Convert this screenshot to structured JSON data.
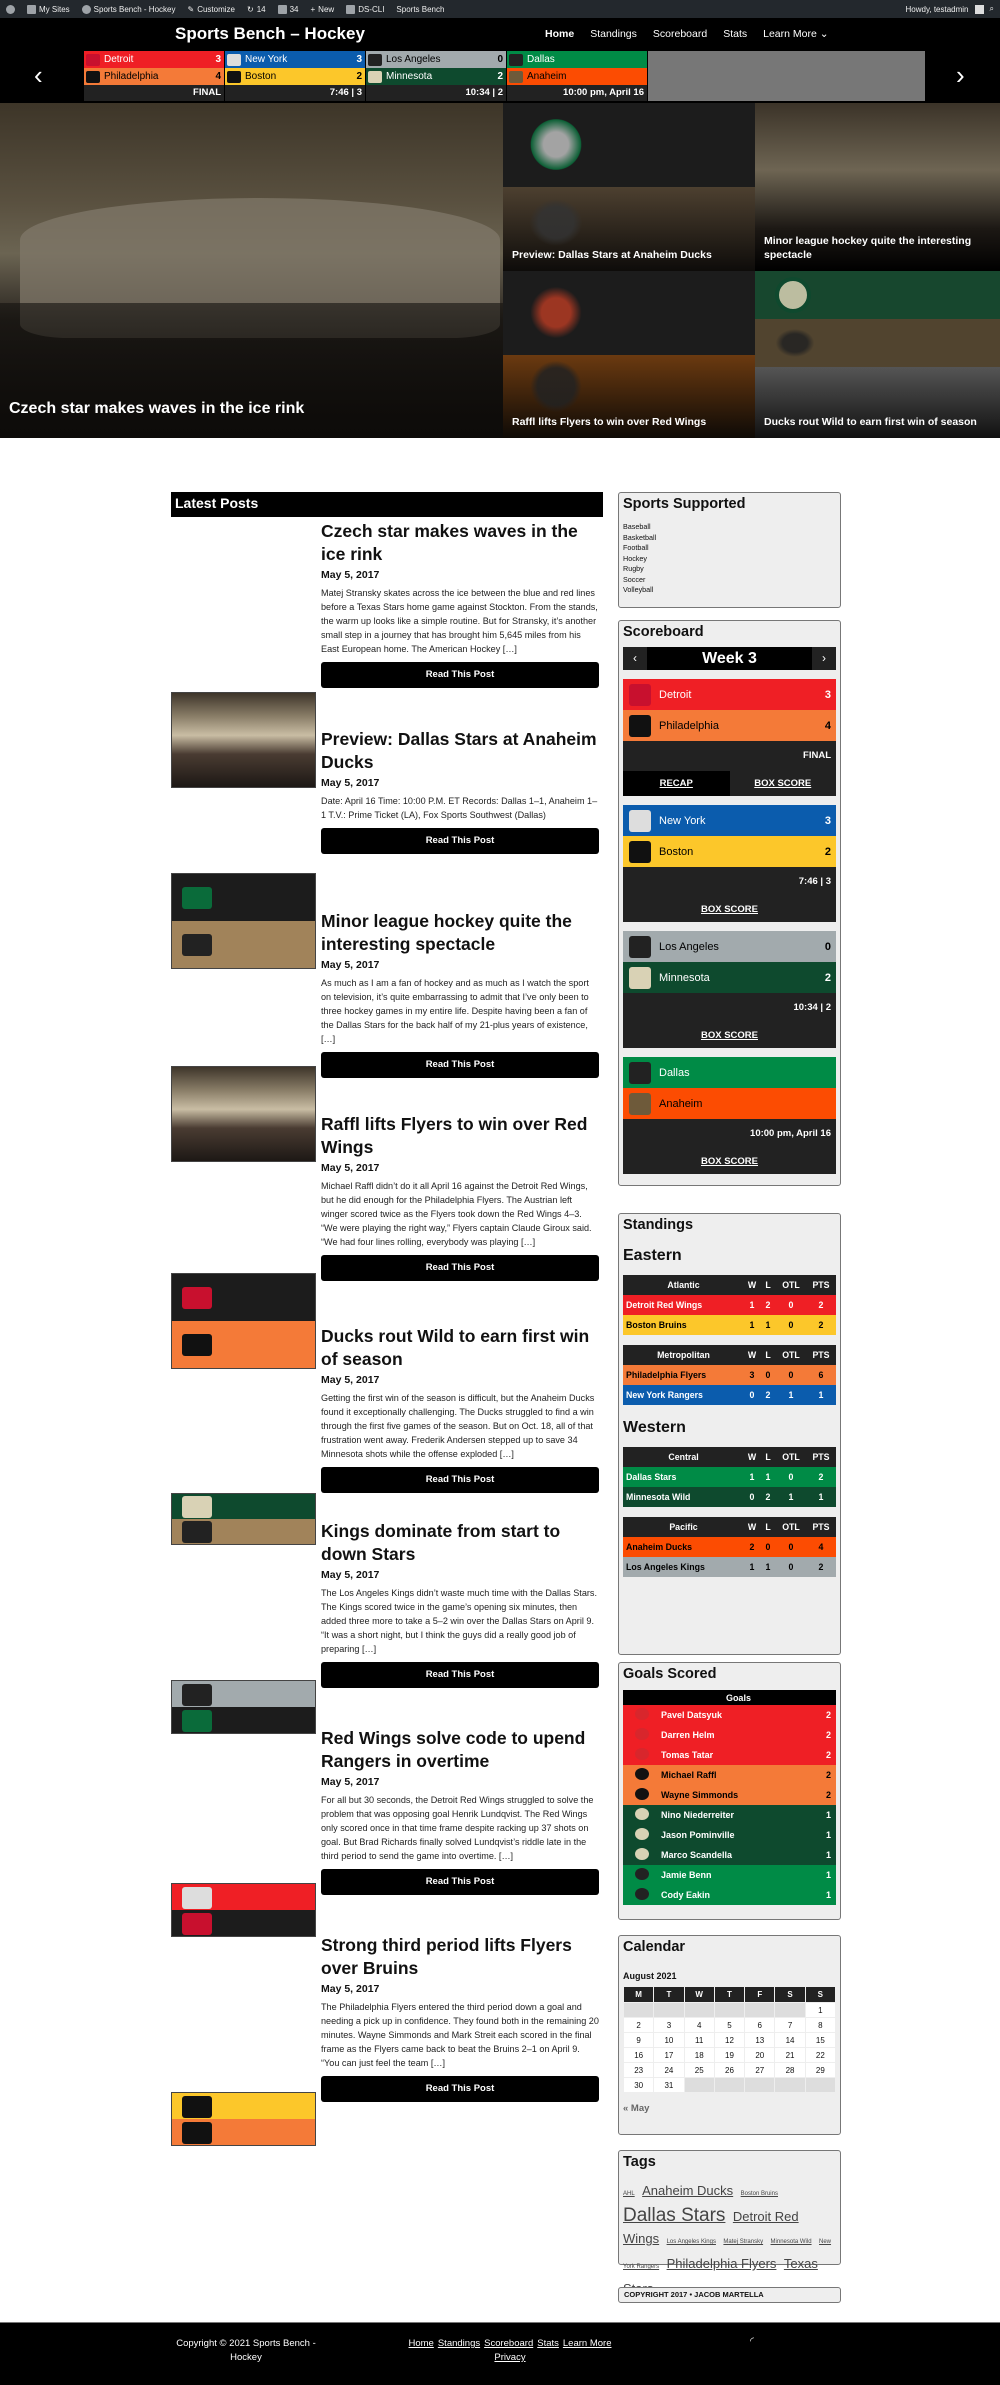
{
  "admin_bar": {
    "items": [
      "My Sites",
      "Sports Bench - Hockey",
      "Customize",
      "14",
      "34",
      "New",
      "DS-CLI",
      "Sports Bench"
    ],
    "greeting": "Howdy, testadmin"
  },
  "header": {
    "site_title": "Sports Bench – Hockey",
    "nav": [
      {
        "label": "Home",
        "active": true
      },
      {
        "label": "Standings"
      },
      {
        "label": "Scoreboard"
      },
      {
        "label": "Stats"
      },
      {
        "label": "Learn More ⌄"
      }
    ],
    "prev_arrow": "‹",
    "next_arrow": "›"
  },
  "ticker": [
    {
      "away": {
        "name": "Detroit",
        "score": "3",
        "color": "#ef1f25",
        "text": "#fff"
      },
      "home": {
        "name": "Philadelphia",
        "score": "4",
        "color": "#f47a38",
        "text": "#000"
      },
      "status": "FINAL"
    },
    {
      "away": {
        "name": "New York",
        "score": "3",
        "color": "#0b5cad",
        "text": "#fff"
      },
      "home": {
        "name": "Boston",
        "score": "2",
        "color": "#fcc72a",
        "text": "#000"
      },
      "status": "7:46 | 3"
    },
    {
      "away": {
        "name": "Los Angeles",
        "score": "0",
        "color": "#a2aaad",
        "text": "#000"
      },
      "home": {
        "name": "Minnesota",
        "score": "2",
        "color": "#0e4a2e",
        "text": "#fff"
      },
      "status": "10:34 | 2"
    },
    {
      "away": {
        "name": "Dallas",
        "score": "",
        "color": "#008b46",
        "text": "#fff"
      },
      "home": {
        "name": "Anaheim",
        "score": "",
        "color": "#fc4c02",
        "text": "#000"
      },
      "status": "10:00 pm, April 16"
    }
  ],
  "hero": {
    "main": "Czech star makes waves in the ice rink",
    "tiles": [
      "Preview: Dallas Stars at Anaheim Ducks",
      "Minor league hockey quite the interesting spectacle",
      "Raffl lifts Flyers to win over Red Wings",
      "Ducks rout Wild to earn first win of season"
    ]
  },
  "latest_posts": {
    "heading": "Latest Posts",
    "button_label": "Read This Post",
    "posts": [
      {
        "title": "Czech star makes waves in the ice rink",
        "date": "May 5, 2017",
        "excerpt": "Matej Stransky skates across the ice between the blue and red lines before a Texas Stars home game against Stockton. From the stands, the warm up looks like a simple routine. But for Stransky, it’s another small step in a journey that has brought him 5,645 miles from his East European home. The American Hockey […]"
      },
      {
        "title": "Preview: Dallas Stars at Anaheim Ducks",
        "date": "May 5, 2017",
        "excerpt": "Date: April 16 Time: 10:00 P.M. ET Records: Dallas 1–1, Anaheim 1–1 T.V.: Prime Ticket (LA), Fox Sports Southwest (Dallas)"
      },
      {
        "title": "Minor league hockey quite the interesting spectacle",
        "date": "May 5, 2017",
        "excerpt": "As much as I am a fan of hockey and as much as I watch the sport on television, it’s quite embarrassing to admit that I’ve only been to three hockey games in my entire life. Despite having been a fan of the Dallas Stars for the back half of my 21-plus years of existence, […]"
      },
      {
        "title": "Raffl lifts Flyers to win over Red Wings",
        "date": "May 5, 2017",
        "excerpt": "Michael Raffl didn’t do it all April 16 against the Detroit Red Wings, but he did enough for the Philadelphia Flyers. The Austrian left winger scored twice as the Flyers took down the Red Wings 4–3. “We were playing the right way,” Flyers captain Claude Giroux said. “We had four lines rolling, everybody was playing […]"
      },
      {
        "title": "Ducks rout Wild to earn first win of season",
        "date": "May 5, 2017",
        "excerpt": "Getting the first win of the season is difficult, but the Anaheim Ducks found it exceptionally challenging. The Ducks struggled to find a win through the first five games of the season. But on Oct. 18, all of that frustration went away. Frederik Andersen stepped up to save 34 Minnesota shots while the offense exploded […]"
      },
      {
        "title": "Kings dominate from start to down Stars",
        "date": "May 5, 2017",
        "excerpt": "The Los Angeles Kings didn’t waste much time with the Dallas Stars. The Kings scored twice in the game’s opening six minutes, then added three more to take a 5–2 win over the Dallas Stars on April 9. “It was a short night, but I think the guys did a really good job of preparing […]"
      },
      {
        "title": "Red Wings solve code to upend Rangers in overtime",
        "date": "May 5, 2017",
        "excerpt": "For all but 30 seconds, the Detroit Red Wings struggled to solve the problem that was opposing goal Henrik Lundqvist. The Red Wings only scored once in that time frame despite racking up 37 shots on goal. But Brad Richards finally solved Lundqvist’s riddle late in the third period to send the game into overtime. […]"
      },
      {
        "title": "Strong third period lifts Flyers over Bruins",
        "date": "May 5, 2017",
        "excerpt": "The Philadelphia Flyers entered the third period down a goal and needing a pick up in confidence. They found both in the remaining 20 minutes. Wayne Simmonds and Mark Streit each scored in the final frame as the Flyers came back to beat the Bruins 2–1 on April 9. “You can just feel the team […]"
      }
    ]
  },
  "sidebar": {
    "sports": {
      "title": "Sports Supported",
      "items": [
        "Baseball",
        "Basketball",
        "Football",
        "Hockey",
        "Rugby",
        "Soccer",
        "Volleyball"
      ]
    },
    "scoreboard": {
      "title": "Scoreboard",
      "week": "Week 3",
      "recap_label": "RECAP",
      "box_label": "BOX SCORE"
    },
    "standings": {
      "title": "Standings",
      "cols": [
        "W",
        "L",
        "OTL",
        "PTS"
      ],
      "conferences": [
        {
          "name": "Eastern",
          "divisions": [
            {
              "name": "Atlantic",
              "rows": [
                {
                  "team": "Detroit Red Wings",
                  "w": "1",
                  "l": "2",
                  "otl": "0",
                  "pts": "2",
                  "color": "#ef1f25",
                  "text": "#fff"
                },
                {
                  "team": "Boston Bruins",
                  "w": "1",
                  "l": "1",
                  "otl": "0",
                  "pts": "2",
                  "color": "#fcc72a",
                  "text": "#000"
                }
              ]
            },
            {
              "name": "Metropolitan",
              "rows": [
                {
                  "team": "Philadelphia Flyers",
                  "w": "3",
                  "l": "0",
                  "otl": "0",
                  "pts": "6",
                  "color": "#f47a38",
                  "text": "#000"
                },
                {
                  "team": "New York Rangers",
                  "w": "0",
                  "l": "2",
                  "otl": "1",
                  "pts": "1",
                  "color": "#0b5cad",
                  "text": "#fff"
                }
              ]
            }
          ]
        },
        {
          "name": "Western",
          "divisions": [
            {
              "name": "Central",
              "rows": [
                {
                  "team": "Dallas Stars",
                  "w": "1",
                  "l": "1",
                  "otl": "0",
                  "pts": "2",
                  "color": "#008b46",
                  "text": "#fff"
                },
                {
                  "team": "Minnesota Wild",
                  "w": "0",
                  "l": "2",
                  "otl": "1",
                  "pts": "1",
                  "color": "#0e4a2e",
                  "text": "#fff"
                }
              ]
            },
            {
              "name": "Pacific",
              "rows": [
                {
                  "team": "Anaheim Ducks",
                  "w": "2",
                  "l": "0",
                  "otl": "0",
                  "pts": "4",
                  "color": "#fc4c02",
                  "text": "#000"
                },
                {
                  "team": "Los Angeles Kings",
                  "w": "1",
                  "l": "1",
                  "otl": "0",
                  "pts": "2",
                  "color": "#a2aaad",
                  "text": "#000"
                }
              ]
            }
          ]
        }
      ]
    },
    "goals": {
      "title": "Goals Scored",
      "header": "Goals",
      "rows": [
        {
          "player": "Pavel Datsyuk",
          "goals": "2",
          "color": "#ef1f25",
          "text": "#fff",
          "logo": "#d8262c"
        },
        {
          "player": "Darren Helm",
          "goals": "2",
          "color": "#ef1f25",
          "text": "#fff",
          "logo": "#d8262c"
        },
        {
          "player": "Tomas Tatar",
          "goals": "2",
          "color": "#ef1f25",
          "text": "#fff",
          "logo": "#d8262c"
        },
        {
          "player": "Michael Raffl",
          "goals": "2",
          "color": "#f47a38",
          "text": "#000",
          "logo": "#111"
        },
        {
          "player": "Wayne Simmonds",
          "goals": "2",
          "color": "#f47a38",
          "text": "#000",
          "logo": "#111"
        },
        {
          "player": "Nino Niederreiter",
          "goals": "1",
          "color": "#0e4a2e",
          "text": "#fff",
          "logo": "#d9d2b5"
        },
        {
          "player": "Jason Pominville",
          "goals": "1",
          "color": "#0e4a2e",
          "text": "#fff",
          "logo": "#d9d2b5"
        },
        {
          "player": "Marco Scandella",
          "goals": "1",
          "color": "#0e4a2e",
          "text": "#fff",
          "logo": "#d9d2b5"
        },
        {
          "player": "Jamie Benn",
          "goals": "1",
          "color": "#008b46",
          "text": "#fff",
          "logo": "#222"
        },
        {
          "player": "Cody Eakin",
          "goals": "1",
          "color": "#008b46",
          "text": "#fff",
          "logo": "#222"
        }
      ]
    },
    "calendar": {
      "title": "Calendar",
      "month": "August 2021",
      "days": [
        "M",
        "T",
        "W",
        "T",
        "F",
        "S",
        "S"
      ],
      "weeks": [
        [
          "",
          "",
          "",
          "",
          "",
          "",
          "1"
        ],
        [
          "2",
          "3",
          "4",
          "5",
          "6",
          "7",
          "8"
        ],
        [
          "9",
          "10",
          "11",
          "12",
          "13",
          "14",
          "15"
        ],
        [
          "16",
          "17",
          "18",
          "19",
          "20",
          "21",
          "22"
        ],
        [
          "23",
          "24",
          "25",
          "26",
          "27",
          "28",
          "29"
        ],
        [
          "30",
          "31",
          "",
          "",
          "",
          "",
          ""
        ]
      ],
      "prev": "« May"
    },
    "tags": {
      "title": "Tags",
      "items": [
        {
          "label": "AHL",
          "size": "s"
        },
        {
          "label": "Anaheim Ducks",
          "size": "l"
        },
        {
          "label": "Boston Bruins",
          "size": "s"
        },
        {
          "label": "Dallas Stars",
          "size": "xl"
        },
        {
          "label": "Detroit Red Wings",
          "size": "l"
        },
        {
          "label": "Los Angeles Kings",
          "size": "s"
        },
        {
          "label": "Matej Stransky",
          "size": "s"
        },
        {
          "label": "Minnesota Wild",
          "size": "s"
        },
        {
          "label": "New York Rangers",
          "size": "s"
        },
        {
          "label": "Philadelphia Flyers",
          "size": "l"
        },
        {
          "label": "Texas Stars",
          "size": "l"
        }
      ]
    },
    "copyright": "COPYRIGHT 2017 • JACOB MARTELLA"
  },
  "footer": {
    "copyright": "Copyright © 2021 Sports Bench - Hockey",
    "nav": [
      "Home",
      "Standings",
      "Scoreboard",
      "Stats",
      "Learn More",
      "Privacy"
    ],
    "rss": "☰"
  }
}
